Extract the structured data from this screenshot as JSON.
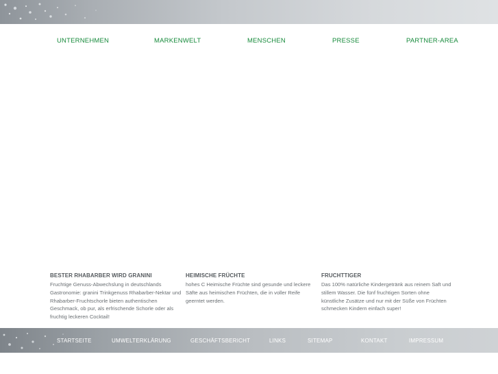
{
  "colors": {
    "nav_link": "#168a3b",
    "heading": "#555a5e",
    "body_text": "#6a6f73",
    "footer_link": "#ffffff"
  },
  "nav": {
    "items": [
      {
        "label": "UNTERNEHMEN"
      },
      {
        "label": "MARKENWELT"
      },
      {
        "label": "MENSCHEN"
      },
      {
        "label": "PRESSE"
      },
      {
        "label": "PARTNER-AREA"
      }
    ]
  },
  "teasers": [
    {
      "title": "BESTER RHABARBER WIRD GRANINI",
      "text": "Fruchtige Genuss-Abwechslung in deutschlands Gastronomie: granini Trinkgenuss Rhabarber-Nektar und Rhabarber-Fruchtschorle bieten authentischen Geschmack, ob pur, als erfrischende Schorle oder als fruchtig leckeren Cocktail!"
    },
    {
      "title": "HEIMISCHE FRÜCHTE",
      "text": "hohes C Heimische Früchte sind gesunde und leckere Säfte aus heimischen Früchten, die in voller Reife geerntet werden."
    },
    {
      "title": "FRUCHTTIGER",
      "text": "Das 100% natürliche Kindergetränk aus reinem Saft und stillem Wasser. Die fünf fruchtigen Sorten ohne künstliche Zusätze und nur mit der Süße von Früchten schmecken Kindern einfach super!"
    }
  ],
  "footer": {
    "items": [
      {
        "label": "STARTSEITE"
      },
      {
        "label": "UMWELTERKLÄRUNG"
      },
      {
        "label": "GESCHÄFTSBERICHT"
      },
      {
        "label": "LINKS"
      },
      {
        "label": "SITEMAP"
      },
      {
        "label": "KONTAKT"
      },
      {
        "label": "IMPRESSUM"
      }
    ]
  }
}
